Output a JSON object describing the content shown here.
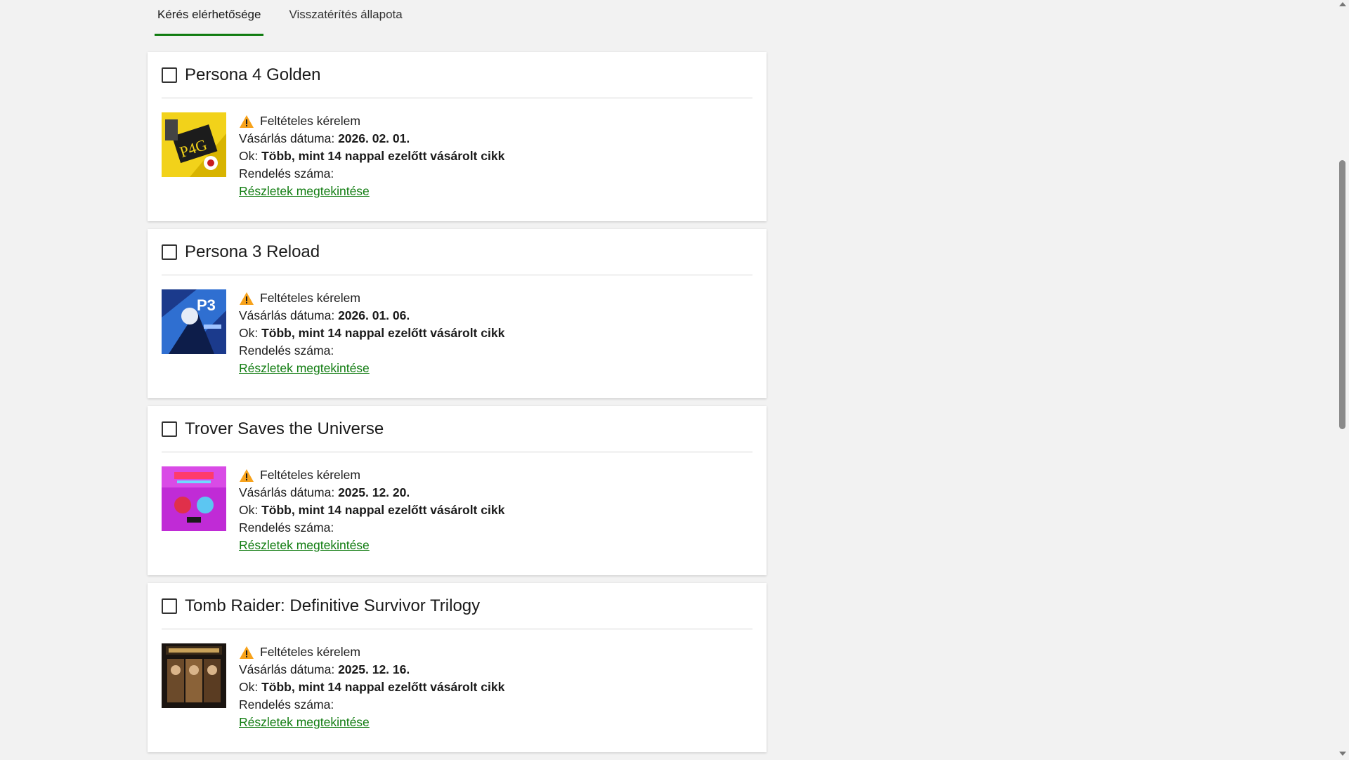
{
  "tabs": [
    {
      "label": "Kérés elérhetősége",
      "active": true
    },
    {
      "label": "Visszatérítés állapota",
      "active": false
    }
  ],
  "labels": {
    "status": "Feltételes kérelem",
    "purchase_date": "Vásárlás dátuma:",
    "reason": "Ok:",
    "order_number": "Rendelés száma:",
    "details_link": "Részletek megtekintése"
  },
  "items": [
    {
      "title": "Persona 4 Golden",
      "status": "Feltételes kérelem",
      "purchase_date_label": "Vásárlás dátuma:",
      "purchase_date": "2026. 02. 01.",
      "reason_label": "Ok:",
      "reason": "Több, mint 14 nappal ezelőtt vásárolt cikk",
      "order_label": "Rendelés száma:",
      "link": "Részletek megtekintése",
      "thumb_icon": "persona4-cover"
    },
    {
      "title": "Persona 3 Reload",
      "status": "Feltételes kérelem",
      "purchase_date_label": "Vásárlás dátuma:",
      "purchase_date": "2026. 01. 06.",
      "reason_label": "Ok:",
      "reason": "Több, mint 14 nappal ezelőtt vásárolt cikk",
      "order_label": "Rendelés száma:",
      "link": "Részletek megtekintése",
      "thumb_icon": "persona3-cover"
    },
    {
      "title": "Trover Saves the Universe",
      "status": "Feltételes kérelem",
      "purchase_date_label": "Vásárlás dátuma:",
      "purchase_date": "2025. 12. 20.",
      "reason_label": "Ok:",
      "reason": "Több, mint 14 nappal ezelőtt vásárolt cikk",
      "order_label": "Rendelés száma:",
      "link": "Részletek megtekintése",
      "thumb_icon": "trover-cover"
    },
    {
      "title": "Tomb Raider: Definitive Survivor Trilogy",
      "status": "Feltételes kérelem",
      "purchase_date_label": "Vásárlás dátuma:",
      "purchase_date": "2025. 12. 16.",
      "reason_label": "Ok:",
      "reason": "Több, mint 14 nappal ezelőtt vásárolt cikk",
      "order_label": "Rendelés száma:",
      "link": "Részletek megtekintése",
      "thumb_icon": "tombraider-cover"
    }
  ],
  "colors": {
    "accent": "#107c10",
    "warning": "#f7a21b"
  }
}
